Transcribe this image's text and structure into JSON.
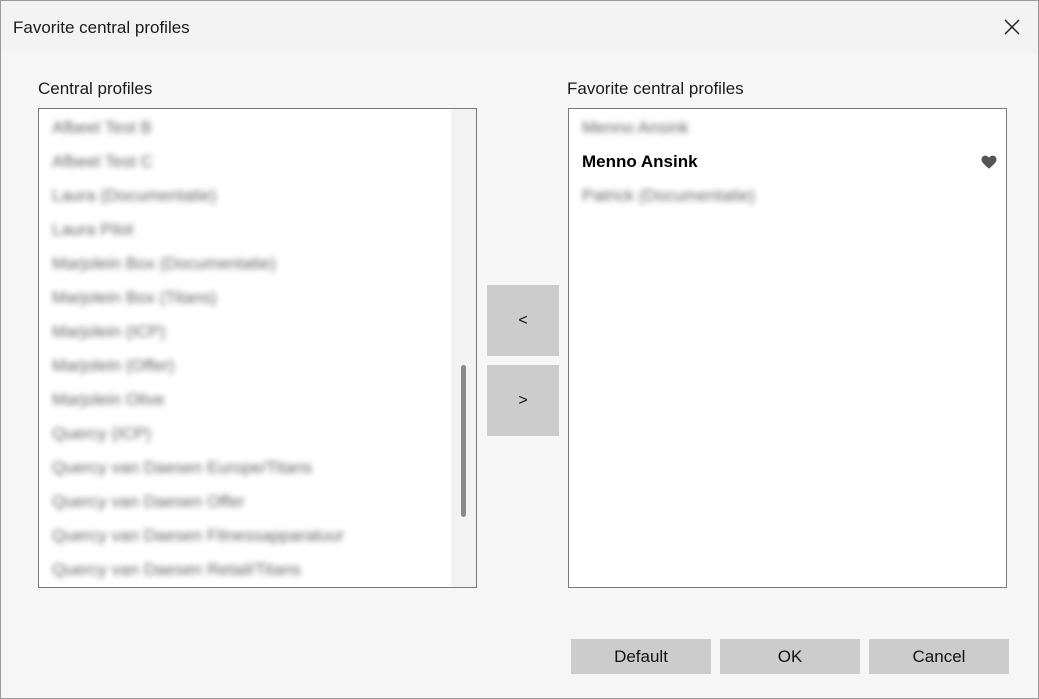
{
  "window": {
    "title": "Favorite central profiles"
  },
  "left_panel": {
    "label": "Central profiles",
    "items": [
      "Afbeel Test B",
      "Afbeel Test C",
      "Laura (Documentatie)",
      "Laura Pilot",
      "Marjolein Box (Documentatie)",
      "Marjolein Box (Titans)",
      "Marjolein (ICP)",
      "Marjolein (Offer)",
      "Marjolein Olive",
      "Quercy (ICP)",
      "Quercy van Daesen Europe/Titans",
      "Quercy van Daesen Offer",
      "Quercy van Daesen Fitnessapparatuur",
      "Quercy van Daesen Retail/Titans"
    ]
  },
  "right_panel": {
    "label": "Favorite central profiles",
    "items": [
      {
        "text": "Menno Ansink",
        "blurred": true
      },
      {
        "text": "Menno Ansink",
        "blurred": false,
        "favorite": true
      },
      {
        "text": "Patrick (Documentatie)",
        "blurred": true
      }
    ]
  },
  "buttons": {
    "move_left": "<",
    "move_right": ">",
    "default": "Default",
    "ok": "OK",
    "cancel": "Cancel"
  },
  "icons": {
    "close": "close-icon",
    "heart": "heart-icon"
  },
  "colors": {
    "button_bg": "#cccccc",
    "window_bg": "#f3f3f3",
    "list_bg": "#ffffff"
  }
}
